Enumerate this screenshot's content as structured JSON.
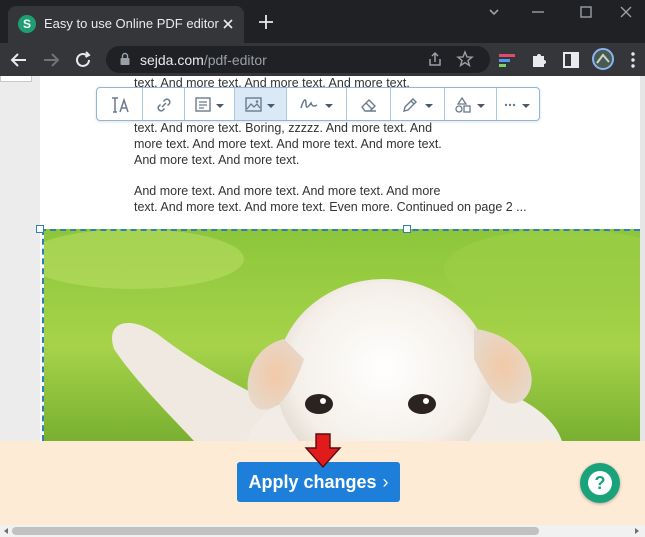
{
  "browser": {
    "tab_title": "Easy to use Online PDF editor",
    "favicon_letter": "S",
    "url_host": "sejda.com",
    "url_path": "/pdf-editor"
  },
  "editor_toolbar": {
    "tools": [
      {
        "name": "text-tool",
        "icon": "text-icon",
        "active": false,
        "dropdown": false
      },
      {
        "name": "link-tool",
        "icon": "link-icon",
        "active": false,
        "dropdown": false
      },
      {
        "name": "forms-tool",
        "icon": "form-icon",
        "active": false,
        "dropdown": true
      },
      {
        "name": "image-tool",
        "icon": "image-icon",
        "active": true,
        "dropdown": true
      },
      {
        "name": "sign-tool",
        "icon": "signature-icon",
        "active": false,
        "dropdown": true
      },
      {
        "name": "eraser-tool",
        "icon": "eraser-icon",
        "active": false,
        "dropdown": false
      },
      {
        "name": "annotate-tool",
        "icon": "pen-icon",
        "active": false,
        "dropdown": true
      },
      {
        "name": "shapes-tool",
        "icon": "shapes-icon",
        "active": false,
        "dropdown": true
      },
      {
        "name": "more-tool",
        "icon": "more-icon",
        "active": false,
        "dropdown": true
      }
    ]
  },
  "document": {
    "lines_top": [
      "text. And more text. And more text. And more text."
    ],
    "paragraph1": [
      "text. And more text. Boring, zzzzz. And more text. And",
      "more text. And more text. And more text. And more text.",
      "And more text. And more text."
    ],
    "paragraph2": [
      "And more text. And more text. And more text. And more",
      "text. And more text. And more text. Even more. Continued on page 2 ..."
    ]
  },
  "actions": {
    "apply_label": "Apply changes",
    "apply_chevron": "›",
    "help_label": "?"
  },
  "colors": {
    "accent": "#1d7fd9",
    "selection": "#2f7fb8",
    "help": "#1aa37a",
    "bottom_bar": "#fdebd6",
    "arrow": "#e11b1b"
  }
}
